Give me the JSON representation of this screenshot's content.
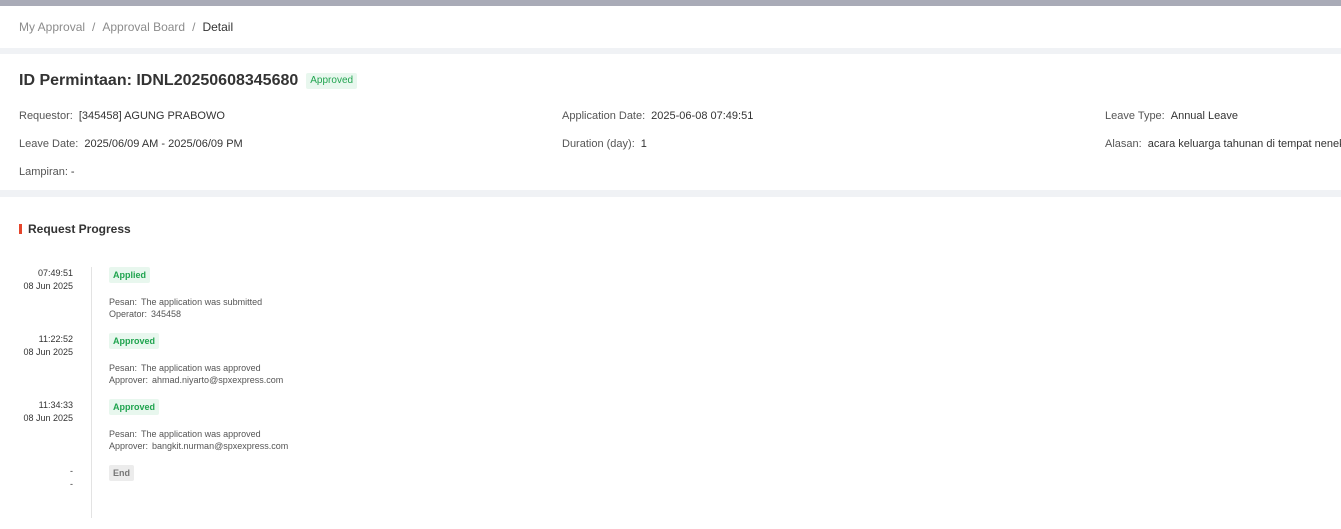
{
  "breadcrumb": {
    "item1": "My Approval",
    "item2": "Approval Board",
    "current": "Detail",
    "separator": "/"
  },
  "detail": {
    "title": "ID Permintaan: IDNL20250608345680",
    "status": "Approved",
    "fields": {
      "requestor": {
        "label": "Requestor:",
        "value": "[345458] AGUNG PRABOWO"
      },
      "application_date": {
        "label": "Application Date:",
        "value": "2025-06-08 07:49:51"
      },
      "leave_type": {
        "label": "Leave Type:",
        "value": "Annual Leave"
      },
      "leave_date": {
        "label": "Leave Date:",
        "value": "2025/06/09 AM - 2025/06/09 PM"
      },
      "duration": {
        "label": "Duration (day):",
        "value": "1"
      },
      "alasan": {
        "label": "Alasan:",
        "value": "acara keluarga tahunan di tempat nenek"
      },
      "lampiran": {
        "label": "Lampiran:",
        "value": "-"
      }
    }
  },
  "progress": {
    "title": "Request Progress",
    "items": [
      {
        "time": "07:49:51",
        "date": "08 Jun 2025",
        "status": "Applied",
        "msg_label": "Pesan:",
        "msg": "The application was submitted",
        "actor_label": "Operator:",
        "actor": "345458"
      },
      {
        "time": "11:22:52",
        "date": "08 Jun 2025",
        "status": "Approved",
        "msg_label": "Pesan:",
        "msg": "The application was approved",
        "actor_label": "Approver:",
        "actor": "ahmad.niyarto@spxexpress.com"
      },
      {
        "time": "11:34:33",
        "date": "08 Jun 2025",
        "status": "Approved",
        "msg_label": "Pesan:",
        "msg": "The application was approved",
        "actor_label": "Approver:",
        "actor": "bangkit.nurman@spxexpress.com"
      },
      {
        "time": "-",
        "date": "-",
        "status": "End"
      }
    ]
  },
  "colors": {
    "accent_red": "#e5452b",
    "approved_green": "#20a44f"
  }
}
